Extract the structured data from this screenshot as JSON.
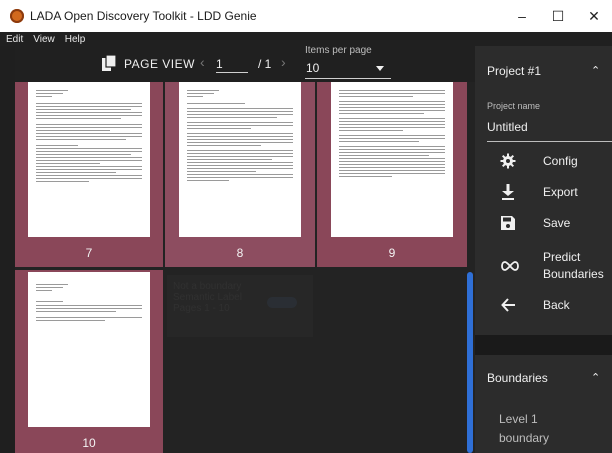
{
  "window": {
    "title": "LADA Open Discovery Toolkit - LDD Genie",
    "controls": [
      "–",
      "☐",
      "✕"
    ]
  },
  "menu": [
    "Edit",
    "View",
    "Help"
  ],
  "toolbar": {
    "page_view_label": "PAGE VIEW",
    "current_page": "1",
    "total_pages": "/ 1",
    "items_per_page_label": "Items per page",
    "items_per_page_value": "10"
  },
  "pages": [
    {
      "number": "7"
    },
    {
      "number": "8"
    },
    {
      "number": "9"
    },
    {
      "number": "10"
    }
  ],
  "ghost_item": {
    "line1": "Not a boundary",
    "line2": "Semantic Label",
    "line3": "Pages 1 - 10"
  },
  "project_panel": {
    "title": "Project #1",
    "project_name_label": "Project name",
    "project_name_value": "Untitled",
    "actions": [
      {
        "label": "Config",
        "icon": "gear-icon"
      },
      {
        "label": "Export",
        "icon": "download-icon"
      },
      {
        "label": "Save",
        "icon": "floppy-disk-icon"
      },
      {
        "label": "Predict Boundaries",
        "icon": "infinity-icon"
      },
      {
        "label": "Back",
        "icon": "arrow-left-icon"
      }
    ]
  },
  "boundaries_panel": {
    "title": "Boundaries",
    "level_label": "Level 1 boundary"
  },
  "colors": {
    "card_background": "#8a4759",
    "panel_background": "#2c2c2c",
    "scrollbar": "#2f6fd6"
  }
}
